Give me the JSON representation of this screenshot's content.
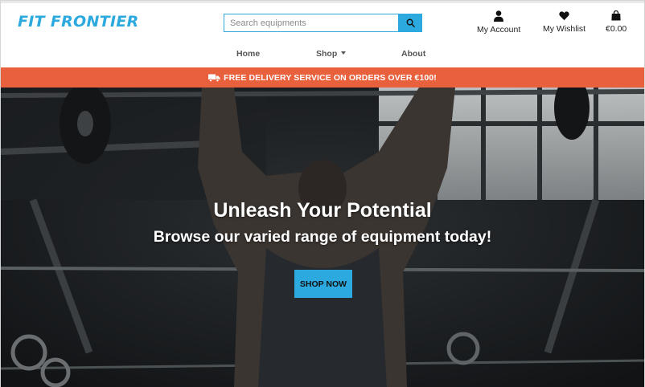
{
  "header": {
    "logo": "FIT FRONTIER",
    "search": {
      "placeholder": "Search equipments"
    },
    "account_label": "My Account",
    "wishlist_label": "My Wishlist",
    "bag_total": "€0.00"
  },
  "nav": {
    "home": "Home",
    "shop": "Shop",
    "about": "About"
  },
  "banner": {
    "text": "FREE DELIVERY SERVICE ON ORDERS OVER €100!"
  },
  "hero": {
    "title": "Unleash Your Potential",
    "subtitle": "Browse our varied range of equipment today!",
    "cta": "SHOP NOW"
  },
  "colors": {
    "brand": "#2ca9de",
    "banner": "#e8603c",
    "icons": [
      "user-icon",
      "heart-icon",
      "shopping-bag-icon",
      "search-icon",
      "truck-icon",
      "caret-down-icon"
    ]
  }
}
